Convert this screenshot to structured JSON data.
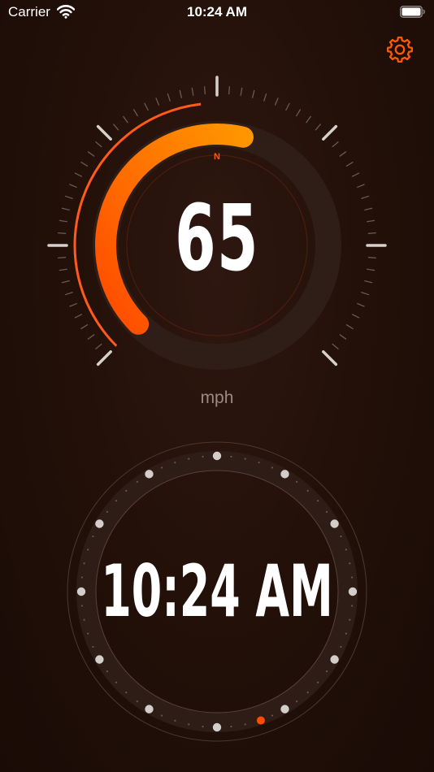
{
  "status_bar": {
    "carrier": "Carrier",
    "time": "10:24 AM"
  },
  "speedometer": {
    "speed": "65",
    "unit": "mph",
    "heading": "N",
    "speed_fraction": 0.55
  },
  "clock": {
    "time": "10:24 AM"
  },
  "colors": {
    "accent": "#ff7a00",
    "accent_dark": "#ff4a00",
    "background": "#231109",
    "tick": "#d8d0cc"
  },
  "icons": {
    "settings": "gear-icon",
    "wifi": "wifi-icon",
    "battery": "battery-icon"
  }
}
